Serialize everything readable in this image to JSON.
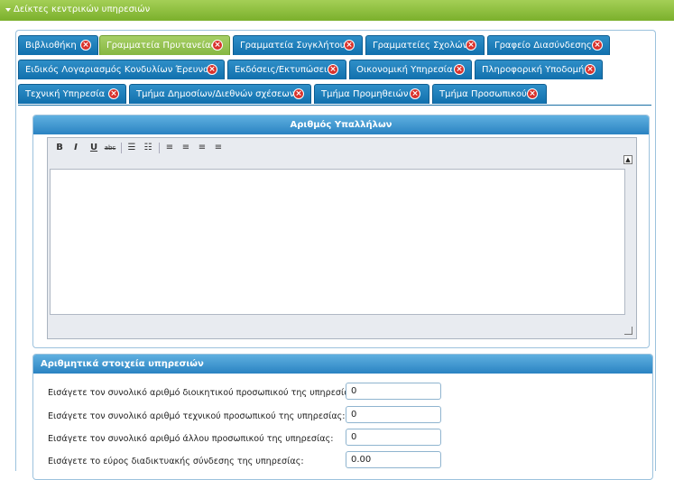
{
  "section_header": {
    "title": "Δείκτες κεντρικών υπηρεσιών"
  },
  "tabs": [
    {
      "label": "Βιβλιοθήκη",
      "active": false
    },
    {
      "label": "Γραμματεία Πρυτανείας",
      "active": true
    },
    {
      "label": "Γραμματεία Συγκλήτου",
      "active": false
    },
    {
      "label": "Γραμματείες Σχολών",
      "active": false
    },
    {
      "label": "Γραφείο Διασύνδεσης",
      "active": false
    },
    {
      "label": "Ειδικός Λογαριασμός Κονδυλίων Έρευνας",
      "active": false
    },
    {
      "label": "Εκδόσεις/Εκτυπώσεις",
      "active": false
    },
    {
      "label": "Οικονομική Υπηρεσία",
      "active": false
    },
    {
      "label": "Πληροφορική Υποδομή",
      "active": false
    },
    {
      "label": "Τεχνική Υπηρεσία",
      "active": false
    },
    {
      "label": "Τμήμα Δημοσίων/Διεθνών σχέσεων",
      "active": false
    },
    {
      "label": "Τμήμα Προμηθειών",
      "active": false
    },
    {
      "label": "Τμήμα Προσωπικού",
      "active": false
    }
  ],
  "tab_close_icon": "×",
  "employees_panel": {
    "title": "Αριθμός Υπαλλήλων",
    "toolbar": {
      "bold": "B",
      "italic": "I",
      "underline": "U",
      "strike": "abc",
      "ul": "☰",
      "ol": "☷",
      "align_left": "≡",
      "align_center": "≡",
      "align_right": "≡",
      "justify": "≡"
    },
    "text_value": ""
  },
  "stats_panel": {
    "title": "Αριθμητικά στοιχεία υπηρεσιών",
    "fields": [
      {
        "label": "Εισάγετε τον συνολικό αριθμό διοικητικού προσωπικού της υπηρεσίας:",
        "value": "0"
      },
      {
        "label": "Εισάγετε τον συνολικό αριθμό τεχνικού προσωπικού της υπηρεσίας:",
        "value": "0"
      },
      {
        "label": "Εισάγετε τον συνολικό αριθμό άλλου προσωπικού της υπηρεσίας:",
        "value": "0"
      },
      {
        "label": "Εισάγετε το εύρος διαδικτυακής σύνδεσης της υπηρεσίας:",
        "value": "0.00"
      }
    ]
  },
  "colors": {
    "green": "#8cbd3f",
    "blue": "#1878b6",
    "close": "#d9322c"
  }
}
